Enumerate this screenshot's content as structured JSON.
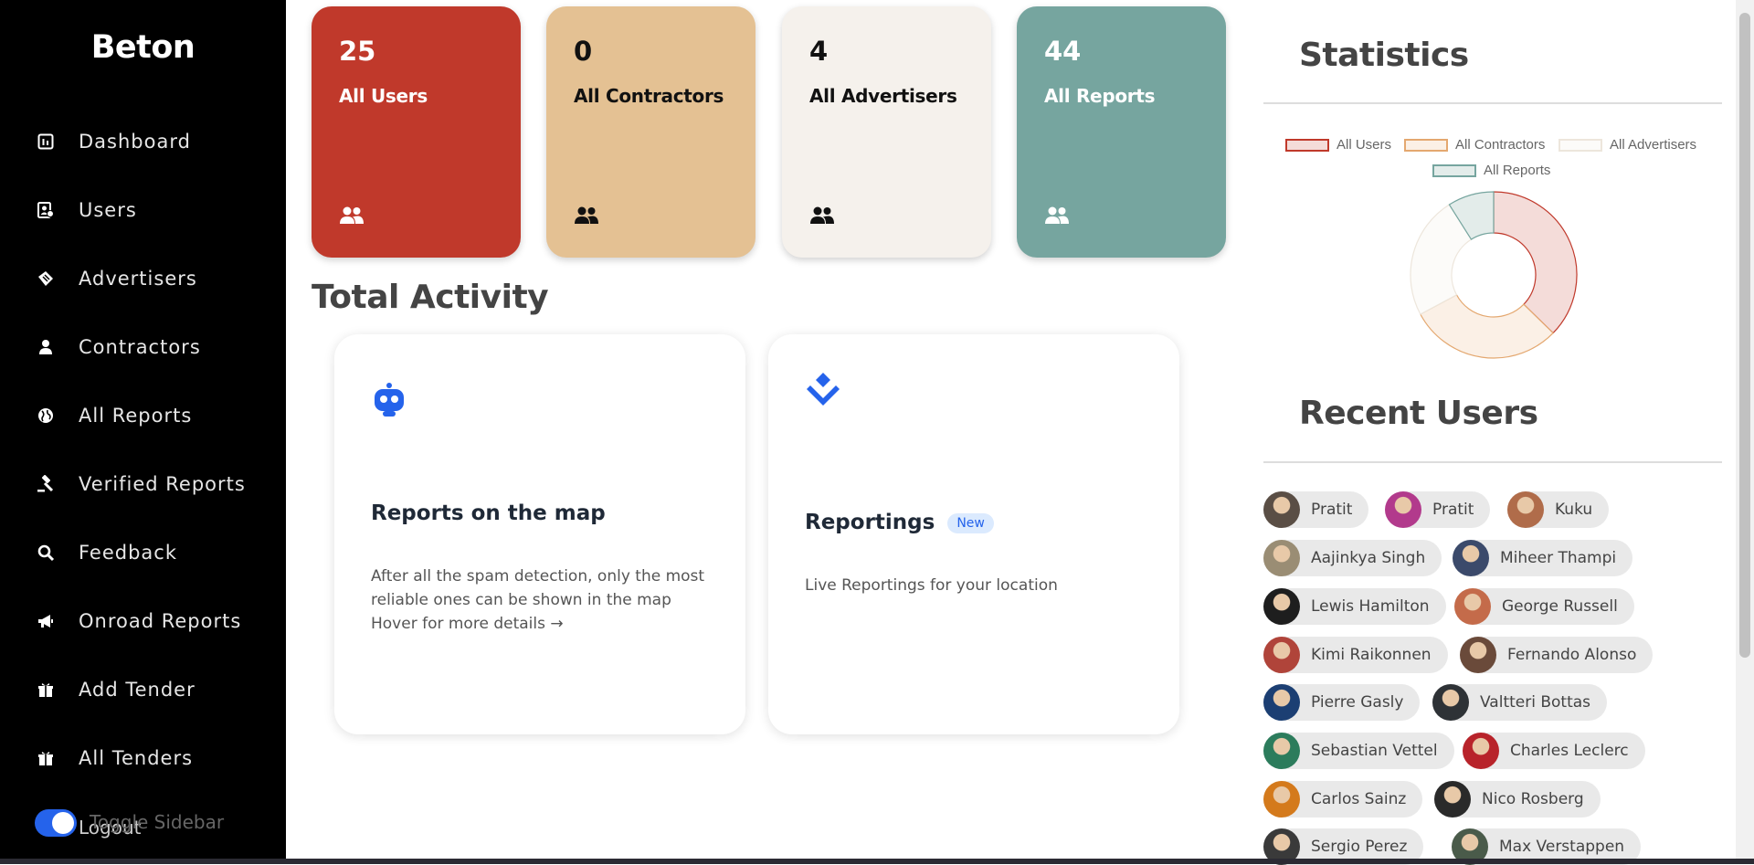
{
  "brand": "Beton",
  "sidebar": {
    "items": [
      {
        "label": "Dashboard",
        "icon": "dashboard-icon"
      },
      {
        "label": "Users",
        "icon": "user-id-icon"
      },
      {
        "label": "Advertisers",
        "icon": "ticket-icon"
      },
      {
        "label": "Contractors",
        "icon": "person-icon"
      },
      {
        "label": "All Reports",
        "icon": "globe-icon"
      },
      {
        "label": "Verified Reports",
        "icon": "gavel-icon"
      },
      {
        "label": "Feedback",
        "icon": "search-icon"
      },
      {
        "label": "Onroad Reports",
        "icon": "megaphone-icon"
      },
      {
        "label": "Add Tender",
        "icon": "gift-icon"
      },
      {
        "label": "All Tenders",
        "icon": "gift-icon"
      }
    ],
    "toggle_label": "Toggle Sidebar",
    "logout_label": "Logout"
  },
  "stats": [
    {
      "value": "25",
      "label": "All Users",
      "color": "#c0392b",
      "text_color": "#ffffff"
    },
    {
      "value": "0",
      "label": "All Contractors",
      "color": "#e4c193",
      "text_color": "#111111"
    },
    {
      "value": "4",
      "label": "All Advertisers",
      "color": "#f5f1ec",
      "text_color": "#111111"
    },
    {
      "value": "44",
      "label": "All Reports",
      "color": "#76a59f",
      "text_color": "#ffffff"
    }
  ],
  "total_activity": {
    "title": "Total Activity",
    "cards": [
      {
        "title": "Reports on the map",
        "desc": "After all the spam detection, only the most reliable ones can be shown in the map",
        "link": "Hover for more details →",
        "icon": "robot-icon"
      },
      {
        "title": "Reportings",
        "badge": "New",
        "desc": "Live Reportings for your location",
        "icon": "layers-icon"
      }
    ]
  },
  "statistics": {
    "title": "Statistics"
  },
  "chart_data": {
    "type": "doughnut",
    "categories": [
      "All Users",
      "All Contractors",
      "All Advertisers",
      "All Reports"
    ],
    "values": [
      25,
      20,
      16,
      6
    ],
    "colors": [
      "#c0392b",
      "#e4a870",
      "#ede6dc",
      "#76a59f"
    ],
    "fills": [
      "#f4dcd9",
      "#fbf0e6",
      "#fcfbf9",
      "#e3ecea"
    ],
    "legend": "top"
  },
  "recent_users": {
    "title": "Recent Users",
    "users": [
      {
        "name": "Pratit",
        "avatar_color": "#5a4e45"
      },
      {
        "name": "Pratit",
        "avatar_color": "#b23a8c"
      },
      {
        "name": "Kuku",
        "avatar_color": "#b06c4a"
      },
      {
        "name": "Aajinkya Singh",
        "avatar_color": "#9a8d74"
      },
      {
        "name": "Miheer Thampi",
        "avatar_color": "#3b4a6b"
      },
      {
        "name": "Lewis Hamilton",
        "avatar_color": "#1e1e1e"
      },
      {
        "name": "George Russell",
        "avatar_color": "#c46b4a"
      },
      {
        "name": "Kimi Raikonnen",
        "avatar_color": "#b0443a"
      },
      {
        "name": "Fernando Alonso",
        "avatar_color": "#6a4a3a"
      },
      {
        "name": "Pierre Gasly",
        "avatar_color": "#1c3f73"
      },
      {
        "name": "Valtteri Bottas",
        "avatar_color": "#2e3236"
      },
      {
        "name": "Sebastian Vettel",
        "avatar_color": "#2c7c5c"
      },
      {
        "name": "Charles Leclerc",
        "avatar_color": "#b8232a"
      },
      {
        "name": "Carlos Sainz",
        "avatar_color": "#d47a1c"
      },
      {
        "name": "Nico Rosberg",
        "avatar_color": "#2a2a2a"
      },
      {
        "name": "Sergio Perez",
        "avatar_color": "#3a3a3a"
      },
      {
        "name": "Max Verstappen",
        "avatar_color": "#4a5b4a"
      }
    ]
  }
}
